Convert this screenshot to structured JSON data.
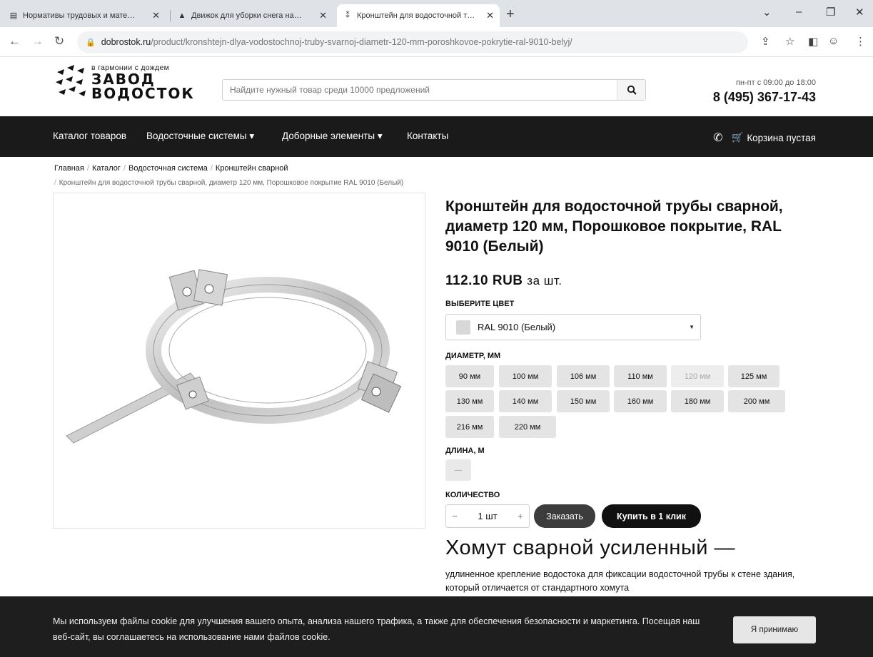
{
  "browser": {
    "tabs": [
      {
        "title": "Нормативы трудовых и мате…",
        "favicon": "doc-icon"
      },
      {
        "title": "Движок для уборки снега на…",
        "favicon": "car-icon"
      },
      {
        "title": "Кронштейн для водосточной т…",
        "favicon": "logo-icon"
      }
    ],
    "url_domain": "dobrostok.ru",
    "url_path": "/product/kronshtejn-dlya-vodostochnoj-truby-svarnoj-diametr-120-mm-poroshkovoe-pokrytie-ral-9010-belyj/"
  },
  "header": {
    "logo_slogan": "в гармонии с дождем",
    "logo_line1": "ЗАВОД",
    "logo_line2": "ВОДОСТОК",
    "search_placeholder": "Найдите нужный товар среди 10000 предложений",
    "hours": "пн-пт с 09:00 до 18:00",
    "phone": "8 (495) 367-17-43"
  },
  "nav": {
    "items": [
      "Каталог товаров",
      "Водосточные системы ▾",
      "Доборные элементы ▾",
      "Контакты"
    ],
    "cart": "Корзина пустая"
  },
  "breadcrumb": {
    "items": [
      "Главная",
      "Каталог",
      "Водосточная система",
      "Кронштейн сварной"
    ],
    "current": "Кронштейн для водосточной трубы сварной, диаметр 120 мм, Порошковое покрытие RAL 9010 (Белый)"
  },
  "product": {
    "title": "Кронштейн для водосточной трубы сварной, диаметр 120 мм, Порошковое покрытие, RAL 9010 (Белый)",
    "price": "112.10 RUB",
    "price_unit": "за шт.",
    "color_label": "ВЫБЕРИТЕ ЦВЕТ",
    "color_value": "RAL 9010 (Белый)",
    "diameter_label": "ДИАМЕТР, ММ",
    "diameters": [
      "90 мм",
      "100 мм",
      "106 мм",
      "110 мм",
      "120 мм",
      "125 мм",
      "130 мм",
      "140 мм",
      "150 мм",
      "160 мм",
      "180 мм",
      "200 мм",
      "216 мм",
      "220 мм"
    ],
    "selected_diameter": "120 мм",
    "length_label": "ДЛИНА, М",
    "length_value": "—",
    "qty_label": "КОЛИЧЕСТВО",
    "qty_minus": "−",
    "qty_value": "1 шт",
    "qty_plus": "+",
    "order_button": "Заказать",
    "buy_button": "Купить в 1 клик",
    "desc_title": "Хомут сварной усиленный —",
    "desc_text": "удлиненное крепление водостока для фиксации водосточной трубы к стене здания, который отличается от стандартного хомута"
  },
  "cookie": {
    "text": "Мы используем файлы cookie для улучшения вашего опыта, анализа нашего трафика, а также для обеспечения безопасности и маркетинга. Посещая наш веб-сайт, вы соглашаетесь на использование нами файлов cookie.",
    "accept": "Я принимаю"
  }
}
